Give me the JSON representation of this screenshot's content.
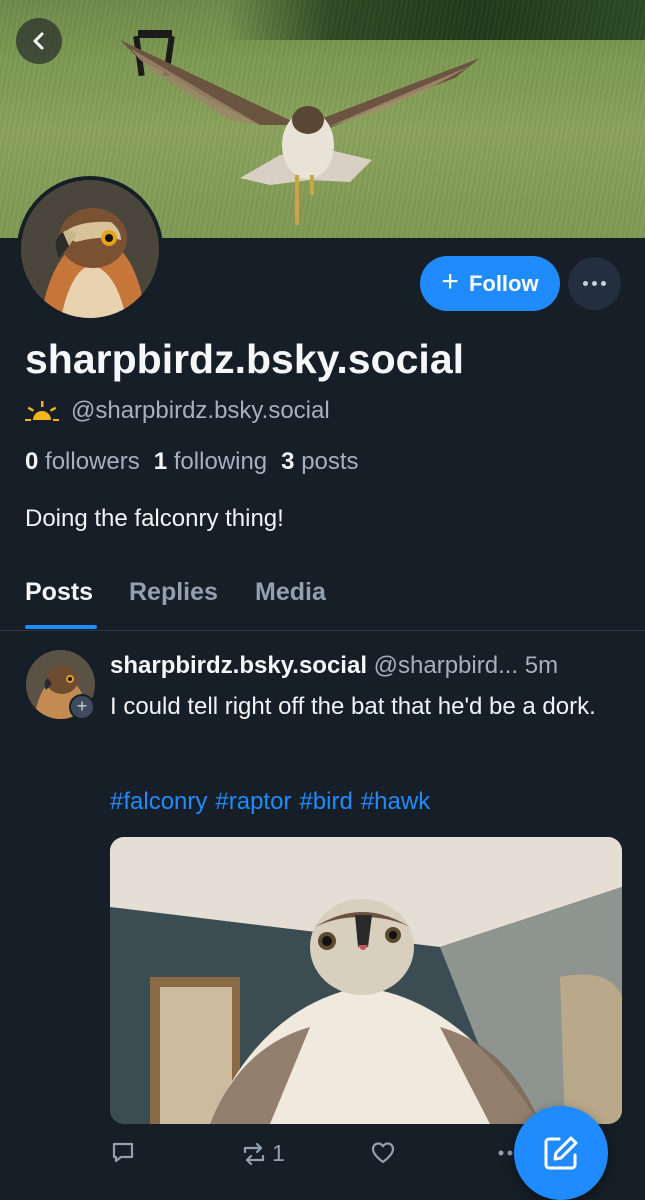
{
  "profile": {
    "display_name": "sharpbirdz.bsky.social",
    "handle": "@sharpbirdz.bsky.social",
    "handle_icon": "sunrise-icon",
    "followers_count": "0",
    "followers_label": "followers",
    "following_count": "1",
    "following_label": "following",
    "posts_count": "3",
    "posts_label": "posts",
    "bio": "Doing the falconry thing!"
  },
  "actions": {
    "follow_label": "Follow",
    "follow_icon": "plus-icon",
    "more_icon": "ellipsis-icon",
    "back_icon": "chevron-left-icon"
  },
  "tabs": [
    {
      "label": "Posts",
      "active": true
    },
    {
      "label": "Replies",
      "active": false
    },
    {
      "label": "Media",
      "active": false
    }
  ],
  "post": {
    "author_name": "sharpbirdz.bsky.social",
    "author_handle": "@sharpbird...",
    "time": "5m",
    "text": "I could tell right off the bat that he'd be a dork.",
    "tags": [
      "#falconry",
      "#raptor",
      "#bird",
      "#hawk"
    ],
    "reply_count": "",
    "repost_count": "1",
    "like_count": ""
  },
  "colors": {
    "accent": "#208bfe",
    "background": "#161e27",
    "muted_text": "#a6b1bf"
  },
  "fab_icon": "compose-icon"
}
